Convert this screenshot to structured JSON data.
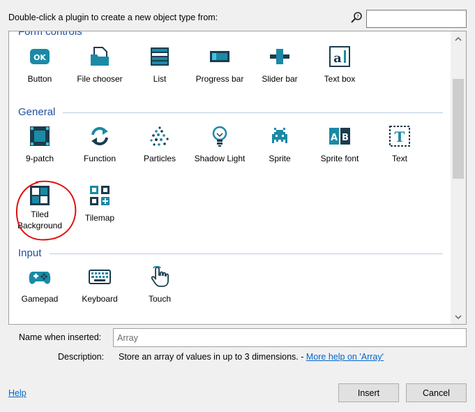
{
  "dialog": {
    "instruction": "Double-click a plugin to create a new object type from:",
    "search": {
      "value": "",
      "icon": "magnifier-icon"
    }
  },
  "sections": {
    "form_controls": {
      "header": "Form controls",
      "items": [
        {
          "label": "Button",
          "icon": "ok-button-icon"
        },
        {
          "label": "File chooser",
          "icon": "file-chooser-icon"
        },
        {
          "label": "List",
          "icon": "list-icon"
        },
        {
          "label": "Progress bar",
          "icon": "progress-bar-icon"
        },
        {
          "label": "Slider bar",
          "icon": "slider-bar-icon"
        },
        {
          "label": "Text box",
          "icon": "text-box-icon"
        }
      ]
    },
    "general": {
      "header": "General",
      "items": [
        {
          "label": "9-patch",
          "icon": "nine-patch-icon"
        },
        {
          "label": "Function",
          "icon": "function-icon"
        },
        {
          "label": "Particles",
          "icon": "particles-icon"
        },
        {
          "label": "Shadow Light",
          "icon": "lightbulb-icon"
        },
        {
          "label": "Sprite",
          "icon": "space-invader-icon"
        },
        {
          "label": "Sprite font",
          "icon": "sprite-font-icon"
        },
        {
          "label": "Text",
          "icon": "text-icon"
        },
        {
          "label": "Tiled Background",
          "icon": "tiled-background-icon"
        },
        {
          "label": "Tilemap",
          "icon": "tilemap-icon"
        }
      ]
    },
    "input": {
      "header": "Input",
      "items": [
        {
          "label": "Gamepad",
          "icon": "gamepad-icon"
        },
        {
          "label": "Keyboard",
          "icon": "keyboard-icon"
        },
        {
          "label": "Touch",
          "icon": "touch-hand-icon"
        }
      ]
    }
  },
  "form": {
    "name_label": "Name when inserted:",
    "name_value": "Array",
    "description_label": "Description:",
    "description_text": "Store an array of values in up to 3 dimensions. -",
    "more_help": "More help on 'Array'"
  },
  "footer": {
    "help": "Help",
    "insert": "Insert",
    "cancel": "Cancel"
  },
  "colors": {
    "icon_teal": "#1a8aa6",
    "icon_dark": "#1c3c4c",
    "header_blue": "#1f4fa0",
    "annotation_red": "#e01010"
  }
}
